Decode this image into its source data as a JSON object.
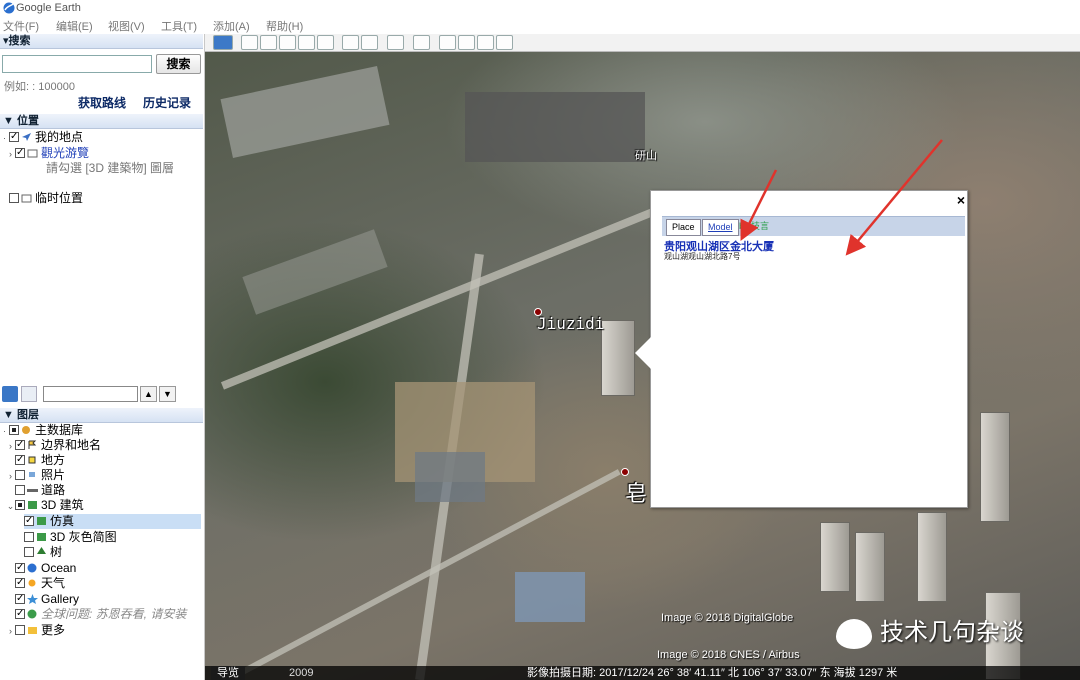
{
  "app": {
    "title": "Google Earth"
  },
  "menu": [
    "文件(F)",
    "编辑(E)",
    "视图(V)",
    "工具(T)",
    "添加(A)",
    "帮助(H)"
  ],
  "search": {
    "header": "▾搜索",
    "button": "搜索",
    "example": "例如: : 100000",
    "directions_link": "获取路线",
    "history_link": "历史记录"
  },
  "places": {
    "header": "▼ 位置",
    "items": [
      {
        "label": "我的地点"
      },
      {
        "label": "觀光游覽"
      },
      {
        "label": "請勾選 [3D 建築物] 圖層"
      },
      {
        "label": "临时位置"
      }
    ]
  },
  "layers": {
    "header": "▼ 图层",
    "items": [
      {
        "label": "主数据库"
      },
      {
        "label": "边界和地名"
      },
      {
        "label": "地方"
      },
      {
        "label": "照片"
      },
      {
        "label": "道路"
      },
      {
        "label": "3D 建筑"
      },
      {
        "label": "仿真"
      },
      {
        "label": "3D 灰色简图"
      },
      {
        "label": "树"
      },
      {
        "label": "Ocean"
      },
      {
        "label": "天气"
      },
      {
        "label": "Gallery"
      },
      {
        "label": "全球问题: 苏恩吞看, 请安装"
      },
      {
        "label": "更多"
      }
    ]
  },
  "map": {
    "labels": {
      "jiuzidi": "Jiuzidi",
      "yanshan": "研山",
      "wang": "皂"
    },
    "balloon": {
      "close": "×",
      "tabs": [
        "Place",
        "Model",
        "by 技言"
      ],
      "name": "贵阳观山湖区金北大厦",
      "address": "观山湖观山湖北路7号"
    },
    "copyright": [
      "Image © 2018 DigitalGlobe",
      "Image © 2018 CNES / Airbus"
    ],
    "watermark": "技术几句杂谈",
    "status": {
      "nav": "导览",
      "year": "2009",
      "info": "影像拍摄日期: 2017/12/24  26° 38′ 41.11″ 北  106° 37′ 33.07″ 东 海拔  1297 米"
    },
    "colors": {
      "arrow": "#e0332c",
      "link": "#1932b6"
    }
  }
}
